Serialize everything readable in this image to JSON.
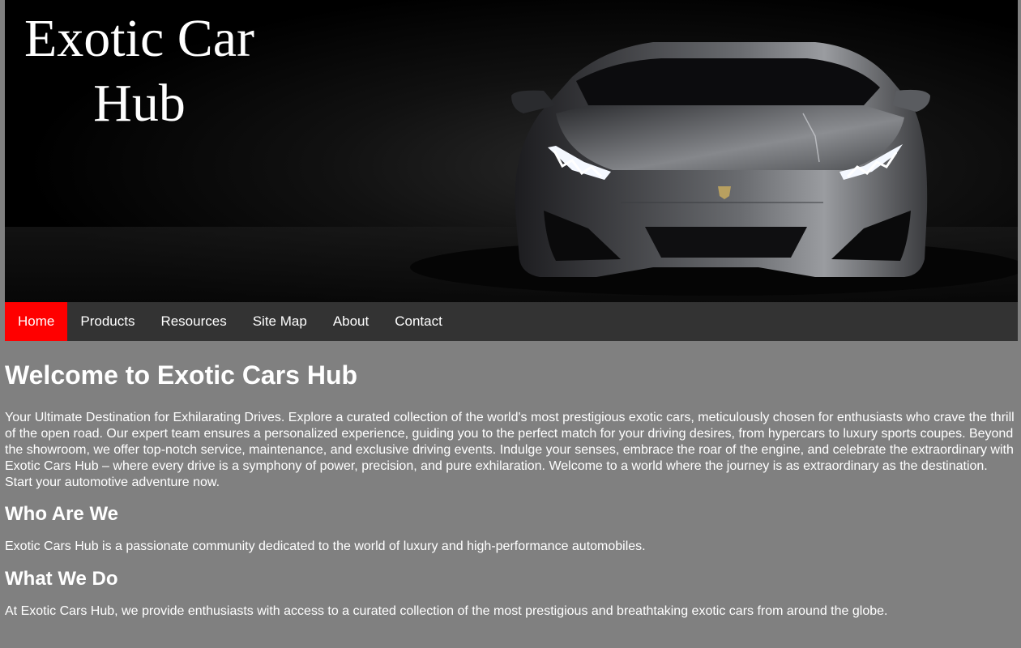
{
  "header": {
    "site_title": "Exotic Car Hub",
    "hero_image": "black-sports-car-headlights"
  },
  "nav": {
    "items": [
      {
        "label": "Home",
        "active": true
      },
      {
        "label": "Products",
        "active": false
      },
      {
        "label": "Resources",
        "active": false
      },
      {
        "label": "Site Map",
        "active": false
      },
      {
        "label": "About",
        "active": false
      },
      {
        "label": "Contact",
        "active": false
      }
    ]
  },
  "main": {
    "heading": "Welcome to Exotic Cars Hub",
    "intro": "Your Ultimate Destination for Exhilarating Drives. Explore a curated collection of the world's most prestigious exotic cars, meticulously chosen for enthusiasts who crave the thrill of the open road. Our expert team ensures a personalized experience, guiding you to the perfect match for your driving desires, from hypercars to luxury sports coupes. Beyond the showroom, we offer top-notch service, maintenance, and exclusive driving events. Indulge your senses, embrace the roar of the engine, and celebrate the extraordinary with Exotic Cars Hub – where every drive is a symphony of power, precision, and pure exhilaration. Welcome to a world where the journey is as extraordinary as the destination. Start your automotive adventure now.",
    "sections": [
      {
        "heading": "Who Are We",
        "text": "Exotic Cars Hub is a passionate community dedicated to the world of luxury and high-performance automobiles."
      },
      {
        "heading": "What We Do",
        "text": "At Exotic Cars Hub, we provide enthusiasts with access to a curated collection of the most prestigious and breathtaking exotic cars from around the globe."
      }
    ]
  },
  "colors": {
    "page_background": "#808080",
    "nav_background": "#333333",
    "nav_active": "#ff0000",
    "text": "#ffffff"
  }
}
